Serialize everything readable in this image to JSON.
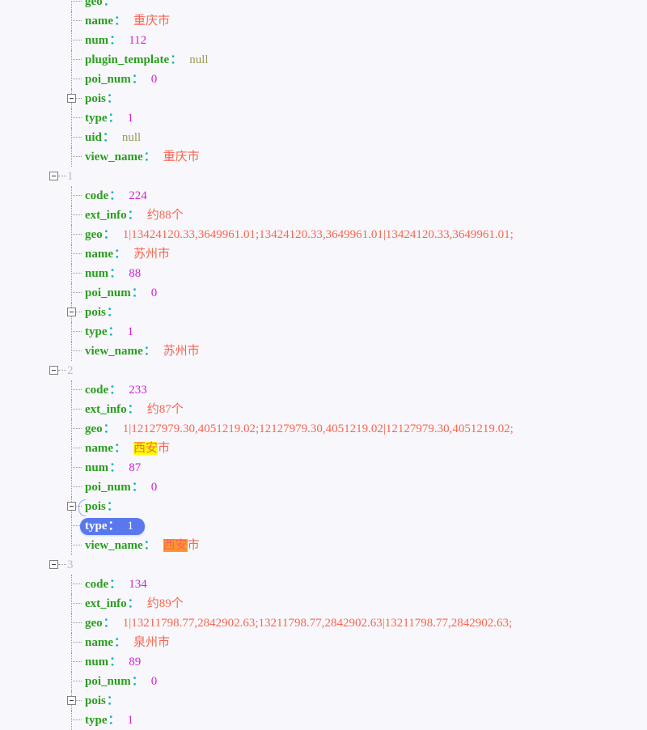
{
  "viewer": {
    "type": "json-tree",
    "background": "#f8f8fc",
    "colors": {
      "key": "#2a9d1e",
      "colon": "#19b6c9",
      "string": "#fa6450",
      "number": "#d420d4",
      "null": "#9a9a55",
      "index": "#b9b9c2",
      "selection": "#5a78ee",
      "highlight_find": "#ffff00",
      "highlight_current": "#ff9632",
      "guide": "#999999"
    },
    "search_term": "西安"
  },
  "rows": [
    {
      "id": "r00",
      "depth": 3,
      "kind": "pair",
      "key": "geo",
      "value": "",
      "vtype": "string",
      "clipped": true,
      "expander": false
    },
    {
      "id": "r01",
      "depth": 3,
      "kind": "pair",
      "key": "name",
      "value": "重庆市",
      "vtype": "string",
      "expander": false
    },
    {
      "id": "r02",
      "depth": 3,
      "kind": "pair",
      "key": "num",
      "value": "112",
      "vtype": "number",
      "expander": false
    },
    {
      "id": "r03",
      "depth": 3,
      "kind": "pair",
      "key": "plugin_template",
      "value": "null",
      "vtype": "null",
      "expander": false
    },
    {
      "id": "r04",
      "depth": 3,
      "kind": "pair",
      "key": "poi_num",
      "value": "0",
      "vtype": "number",
      "expander": false
    },
    {
      "id": "r05",
      "depth": 3,
      "kind": "pair",
      "key": "pois",
      "value": "",
      "vtype": "none",
      "expander": true
    },
    {
      "id": "r06",
      "depth": 3,
      "kind": "pair",
      "key": "type",
      "value": "1",
      "vtype": "number",
      "expander": false
    },
    {
      "id": "r07",
      "depth": 3,
      "kind": "pair",
      "key": "uid",
      "value": "null",
      "vtype": "null",
      "expander": false
    },
    {
      "id": "r08",
      "depth": 3,
      "kind": "pair",
      "key": "view_name",
      "value": "重庆市",
      "vtype": "string",
      "expander": false
    },
    {
      "id": "r09",
      "depth": 2,
      "kind": "index",
      "key": "1",
      "value": "",
      "vtype": "none",
      "expander": true
    },
    {
      "id": "r10",
      "depth": 3,
      "kind": "pair",
      "key": "code",
      "value": "224",
      "vtype": "number",
      "expander": false
    },
    {
      "id": "r11",
      "depth": 3,
      "kind": "pair",
      "key": "ext_info",
      "value": "约88个",
      "vtype": "string",
      "expander": false
    },
    {
      "id": "r12",
      "depth": 3,
      "kind": "pair",
      "key": "geo",
      "value": "1|13424120.33,3649961.01;13424120.33,3649961.01|13424120.33,3649961.01;",
      "vtype": "string",
      "expander": false
    },
    {
      "id": "r13",
      "depth": 3,
      "kind": "pair",
      "key": "name",
      "value": "苏州市",
      "vtype": "string",
      "expander": false
    },
    {
      "id": "r14",
      "depth": 3,
      "kind": "pair",
      "key": "num",
      "value": "88",
      "vtype": "number",
      "expander": false
    },
    {
      "id": "r15",
      "depth": 3,
      "kind": "pair",
      "key": "poi_num",
      "value": "0",
      "vtype": "number",
      "expander": false
    },
    {
      "id": "r16",
      "depth": 3,
      "kind": "pair",
      "key": "pois",
      "value": "",
      "vtype": "none",
      "expander": true
    },
    {
      "id": "r17",
      "depth": 3,
      "kind": "pair",
      "key": "type",
      "value": "1",
      "vtype": "number",
      "expander": false
    },
    {
      "id": "r18",
      "depth": 3,
      "kind": "pair",
      "key": "view_name",
      "value": "苏州市",
      "vtype": "string",
      "expander": false
    },
    {
      "id": "r19",
      "depth": 2,
      "kind": "index",
      "key": "2",
      "value": "",
      "vtype": "none",
      "expander": true
    },
    {
      "id": "r20",
      "depth": 3,
      "kind": "pair",
      "key": "code",
      "value": "233",
      "vtype": "number",
      "expander": false
    },
    {
      "id": "r21",
      "depth": 3,
      "kind": "pair",
      "key": "ext_info",
      "value": "约87个",
      "vtype": "string",
      "expander": false
    },
    {
      "id": "r22",
      "depth": 3,
      "kind": "pair",
      "key": "geo",
      "value": "1|12127979.30,4051219.02;12127979.30,4051219.02|12127979.30,4051219.02;",
      "vtype": "string",
      "expander": false
    },
    {
      "id": "r23",
      "depth": 3,
      "kind": "pair",
      "key": "name",
      "value": "西安市",
      "vtype": "string",
      "expander": false,
      "mark": "yellow",
      "mark_text": "西安",
      "mark_rest": "市"
    },
    {
      "id": "r24",
      "depth": 3,
      "kind": "pair",
      "key": "num",
      "value": "87",
      "vtype": "number",
      "expander": false
    },
    {
      "id": "r25",
      "depth": 3,
      "kind": "pair",
      "key": "poi_num",
      "value": "0",
      "vtype": "number",
      "expander": false
    },
    {
      "id": "r26",
      "depth": 3,
      "kind": "pair",
      "key": "pois",
      "value": "",
      "vtype": "none",
      "expander": true,
      "sel_stub": true
    },
    {
      "id": "r27",
      "depth": 3,
      "kind": "pair",
      "key": "type",
      "value": "1",
      "vtype": "number",
      "expander": false,
      "selected": true
    },
    {
      "id": "r28",
      "depth": 3,
      "kind": "pair",
      "key": "view_name",
      "value": "西安市",
      "vtype": "string",
      "expander": false,
      "mark": "orange",
      "mark_text": "西安",
      "mark_rest": "市"
    },
    {
      "id": "r29",
      "depth": 2,
      "kind": "index",
      "key": "3",
      "value": "",
      "vtype": "none",
      "expander": true
    },
    {
      "id": "r30",
      "depth": 3,
      "kind": "pair",
      "key": "code",
      "value": "134",
      "vtype": "number",
      "expander": false
    },
    {
      "id": "r31",
      "depth": 3,
      "kind": "pair",
      "key": "ext_info",
      "value": "约89个",
      "vtype": "string",
      "expander": false
    },
    {
      "id": "r32",
      "depth": 3,
      "kind": "pair",
      "key": "geo",
      "value": "1|13211798.77,2842902.63;13211798.77,2842902.63|13211798.77,2842902.63;",
      "vtype": "string",
      "expander": false
    },
    {
      "id": "r33",
      "depth": 3,
      "kind": "pair",
      "key": "name",
      "value": "泉州市",
      "vtype": "string",
      "expander": false
    },
    {
      "id": "r34",
      "depth": 3,
      "kind": "pair",
      "key": "num",
      "value": "89",
      "vtype": "number",
      "expander": false
    },
    {
      "id": "r35",
      "depth": 3,
      "kind": "pair",
      "key": "poi_num",
      "value": "0",
      "vtype": "number",
      "expander": false
    },
    {
      "id": "r36",
      "depth": 3,
      "kind": "pair",
      "key": "pois",
      "value": "",
      "vtype": "none",
      "expander": true
    },
    {
      "id": "r37",
      "depth": 3,
      "kind": "pair",
      "key": "type",
      "value": "1",
      "vtype": "number",
      "expander": false
    }
  ]
}
